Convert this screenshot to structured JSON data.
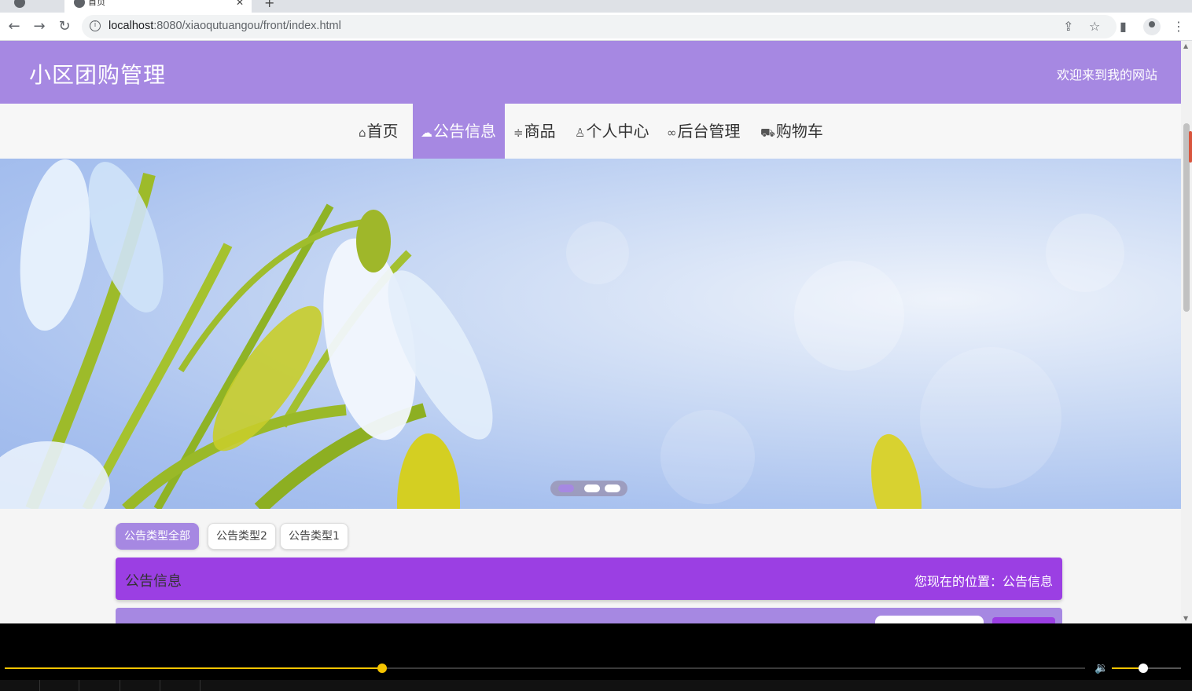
{
  "browser": {
    "tab_title": "首页",
    "url_host": "localhost",
    "url_rest": ":8080/xiaoqutuangou/front/index.html"
  },
  "site": {
    "title": "小区团购管理",
    "welcome": "欢迎来到我的网站"
  },
  "nav": {
    "items": [
      {
        "icon": "home-icon",
        "label": "首页",
        "active": false
      },
      {
        "icon": "cloud-icon",
        "label": "公告信息",
        "active": true
      },
      {
        "icon": "filter-icon",
        "label": "商品",
        "active": false
      },
      {
        "icon": "user-icon",
        "label": "个人中心",
        "active": false
      },
      {
        "icon": "link-icon",
        "label": "后台管理",
        "active": false
      },
      {
        "icon": "cart-icon",
        "label": "购物车",
        "active": false
      }
    ]
  },
  "carousel": {
    "slide_count": 3,
    "active_index": 0
  },
  "filters": {
    "items": [
      "公告类型全部",
      "公告类型2",
      "公告类型1"
    ],
    "active_index": 0
  },
  "section": {
    "title": "公告信息",
    "location": "您现在的位置：公告信息"
  },
  "player": {
    "progress": 0.349,
    "volume": 0.45
  },
  "colors": {
    "header": "#a688e2",
    "title_bar": "#9b3fe3",
    "progress": "#f5c400"
  }
}
